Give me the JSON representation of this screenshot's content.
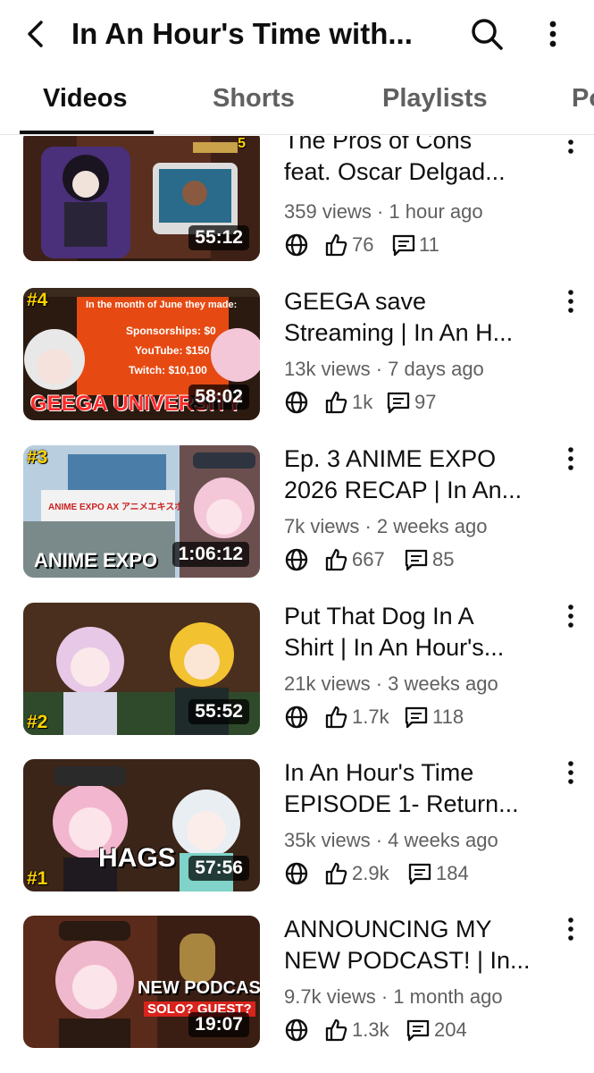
{
  "header": {
    "title": "In An Hour's Time with...",
    "back_icon": "chevron-left-icon",
    "search_icon": "search-icon",
    "more_icon": "more-vertical-icon"
  },
  "tabs": [
    {
      "label": "Videos",
      "active": true
    },
    {
      "label": "Shorts",
      "active": false
    },
    {
      "label": "Playlists",
      "active": false
    },
    {
      "label": "Po",
      "active": false
    }
  ],
  "videos": [
    {
      "title_line1": "The Pros of Cons",
      "title_line2": "feat. Oscar Delgad...",
      "views": "359 views",
      "age": "1 hour ago",
      "likes": "76",
      "comments": "11",
      "duration": "55:12",
      "badge": "5",
      "overlay": "",
      "colors": [
        "#6b3a2a",
        "#3b2a6e",
        "#c9a24a"
      ]
    },
    {
      "title_line1": "GEEGA save",
      "title_line2": "Streaming | In An H...",
      "views": "13k views",
      "age": "7 days ago",
      "likes": "1k",
      "comments": "97",
      "duration": "58:02",
      "badge": "#4",
      "overlay": "GEEGA UNIVERSITY",
      "colors": [
        "#e64a12",
        "#2b1a10",
        "#f0e6dc"
      ]
    },
    {
      "title_line1": "Ep. 3 ANIME EXPO",
      "title_line2": "2026 RECAP | In An...",
      "views": "7k views",
      "age": "2 weeks ago",
      "likes": "667",
      "comments": "85",
      "duration": "1:06:12",
      "badge": "#3",
      "overlay": "ANIME EXPO",
      "colors": [
        "#8fb4d6",
        "#6b4f4f",
        "#f3c6d8"
      ]
    },
    {
      "title_line1": "Put That Dog In A",
      "title_line2": "Shirt | In An Hour's...",
      "views": "21k views",
      "age": "3 weeks ago",
      "likes": "1.7k",
      "comments": "118",
      "duration": "55:52",
      "badge": "#2",
      "overlay": "",
      "colors": [
        "#4a2e1e",
        "#e7c8e6",
        "#f2c230"
      ]
    },
    {
      "title_line1": "In An Hour's Time",
      "title_line2": "EPISODE 1- Return...",
      "views": "35k views",
      "age": "4 weeks ago",
      "likes": "2.9k",
      "comments": "184",
      "duration": "57:56",
      "badge": "#1",
      "overlay": "HAGS",
      "colors": [
        "#3b2418",
        "#f2b6cf",
        "#bfe3f2"
      ]
    },
    {
      "title_line1": "ANNOUNCING MY",
      "title_line2": "NEW PODCAST! | In...",
      "views": "9.7k views",
      "age": "1 month ago",
      "likes": "1.3k",
      "comments": "204",
      "duration": "19:07",
      "badge": "",
      "overlay": "NEW PODCAST",
      "overlay2": "SOLO? GUEST?",
      "colors": [
        "#5a2a1a",
        "#f0b8cc",
        "#2a1a12"
      ]
    }
  ]
}
